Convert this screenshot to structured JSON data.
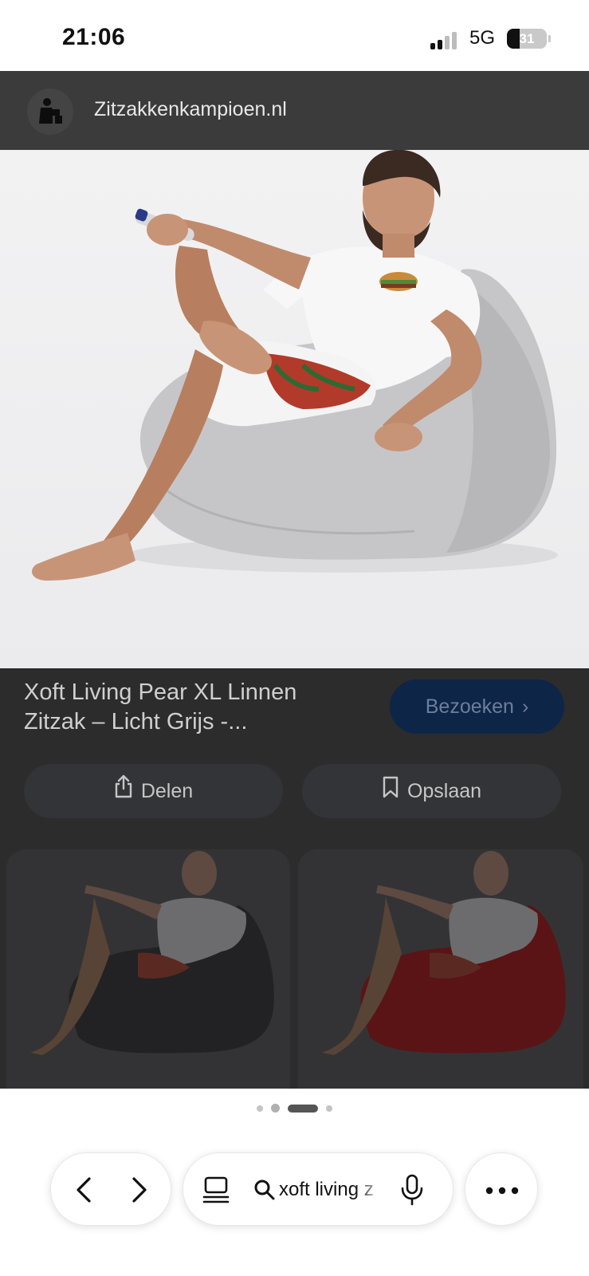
{
  "status_bar": {
    "time": "21:06",
    "network": "5G",
    "battery_percent": "31",
    "battery_level": 0.31
  },
  "site": {
    "name": "Zitzakkenkampioen.nl",
    "icon": "person-reading-logo-icon"
  },
  "hero": {
    "image": "man-on-light-grey-beanbag-photo"
  },
  "product": {
    "title": "Xoft Living Pear XL Linnen Zitzak – Licht Grijs -...",
    "visit_label": "Bezoeken",
    "visit_icon": "chevron-right-icon",
    "share_label": "Delen",
    "share_icon": "share-icon",
    "save_label": "Opslaan",
    "save_icon": "bookmark-icon"
  },
  "related": [
    {
      "image": "man-on-dark-grey-beanbag-photo",
      "color": "#2b2b2d"
    },
    {
      "image": "man-on-red-beanbag-photo",
      "color": "#5a1416"
    }
  ],
  "pagination": {
    "count": 4,
    "active_index": 2
  },
  "toolbar": {
    "back_icon": "chevron-left-icon",
    "forward_icon": "chevron-right-icon",
    "tabs_icon": "tabs-icon",
    "search_icon": "search-icon",
    "search_value": "xoft living z",
    "mic_icon": "microphone-icon",
    "more_icon": "more-dots-icon"
  },
  "colors": {
    "header_bg": "#3b3b3b",
    "panel_bg": "#2c2c2d",
    "visit_button_bg": "#0d2547",
    "beanbag_light": "#c9c9cb"
  }
}
